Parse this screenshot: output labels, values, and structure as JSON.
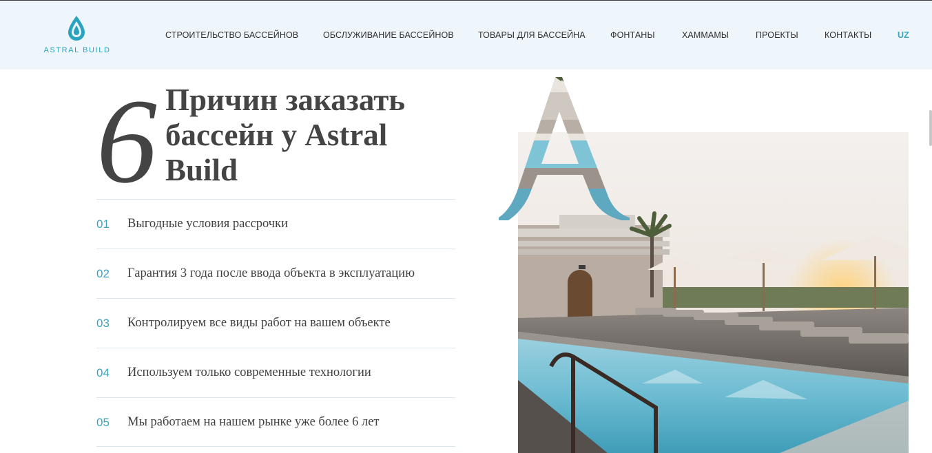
{
  "brand": {
    "name": "ASTRAL BUILD",
    "accent_color": "#3aa4bf",
    "icon": "water-drop-icon"
  },
  "nav": {
    "items": [
      {
        "label": "СТРОИТЕЛЬСТВО БАССЕЙНОВ"
      },
      {
        "label": "ОБСЛУЖИВАНИЕ БАССЕЙНОВ"
      },
      {
        "label": "ТОВАРЫ ДЛЯ БАССЕЙНА"
      },
      {
        "label": "ФОНТАНЫ"
      },
      {
        "label": "ХАММАМЫ"
      },
      {
        "label": "ПРОЕКТЫ"
      },
      {
        "label": "КОНТАКТЫ"
      }
    ],
    "language": "UZ"
  },
  "section": {
    "number": "6",
    "title": "Причин заказать бассейн у Astral Build",
    "reasons": [
      {
        "num": "01",
        "text": "Выгодные условия рассрочки"
      },
      {
        "num": "02",
        "text": "Гарантия 3 года после ввода объекта в эксплуатацию"
      },
      {
        "num": "03",
        "text": "Контролируем все виды работ на вашем объекте"
      },
      {
        "num": "04",
        "text": "Используем только современные технологии"
      },
      {
        "num": "05",
        "text": "Мы работаем на нашем рынке уже более 6 лет"
      }
    ],
    "decor_letter": "A"
  }
}
